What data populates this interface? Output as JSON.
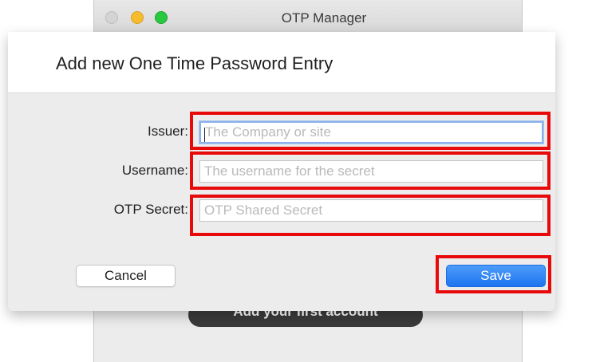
{
  "background_window": {
    "title": "OTP Manager",
    "empty_state_button": "Add your first account"
  },
  "dialog": {
    "title": "Add new One Time Password Entry",
    "fields": {
      "issuer": {
        "label": "Issuer:",
        "value": "",
        "placeholder": "The Company or site"
      },
      "username": {
        "label": "Username:",
        "value": "",
        "placeholder": "The username for the secret"
      },
      "otp_secret": {
        "label": "OTP Secret:",
        "value": "",
        "placeholder": "OTP Shared Secret"
      }
    },
    "buttons": {
      "cancel": "Cancel",
      "save": "Save"
    }
  },
  "colors": {
    "highlight": "#e80a0a",
    "save_button": "#1f74f0",
    "focus_ring": "#8ab2e8",
    "traffic_minimize": "#f6bc2e",
    "traffic_zoom": "#29c840"
  }
}
